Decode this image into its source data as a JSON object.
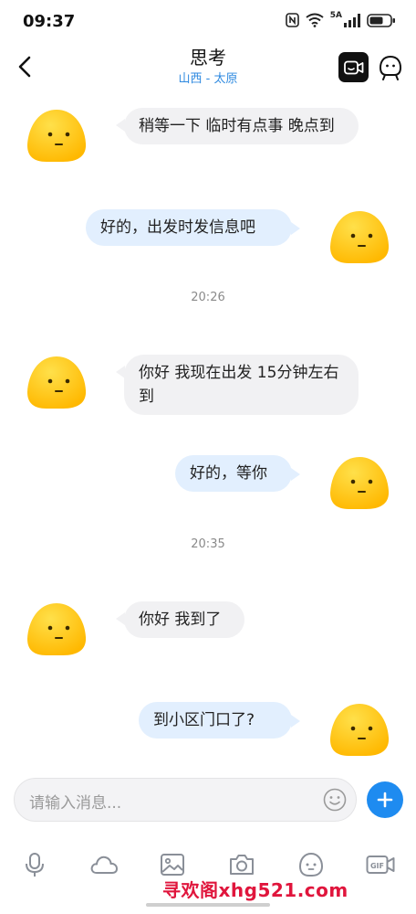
{
  "status_bar": {
    "time": "09:37",
    "network": "5A",
    "icons": [
      "nfc-icon",
      "wifi-icon",
      "signal-icon",
      "battery-icon"
    ]
  },
  "header": {
    "back_icon": "chevron-left-icon",
    "title": "思考",
    "subtitle": "山西 - 太原",
    "video_icon": "video-call-icon",
    "profile_icon": "profile-icon"
  },
  "messages": [
    {
      "direction": "in",
      "text": "稍等一下 临时有点事 晚点到"
    },
    {
      "direction": "out",
      "text": "好的，出发时发信息吧"
    },
    {
      "type": "time",
      "text": "20:26"
    },
    {
      "direction": "in",
      "text": "你好 我现在出发 15分钟左右到"
    },
    {
      "direction": "out",
      "text": "好的，等你"
    },
    {
      "type": "time",
      "text": "20:35"
    },
    {
      "direction": "in",
      "text": "你好 我到了"
    },
    {
      "direction": "out",
      "text": "到小区门口了?"
    }
  ],
  "input": {
    "placeholder": "请输入消息...",
    "emoji_icon": "smiley-icon",
    "plus_icon": "plus-icon"
  },
  "toolbar": [
    "microphone-icon",
    "cloud-icon",
    "image-icon",
    "camera-icon",
    "sticker-icon",
    "gif-icon"
  ],
  "watermark": "寻欢阁xhg521.com",
  "colors": {
    "accent": "#1e8bf0",
    "subtitle": "#2f8ae0",
    "bubble_in": "#f1f1f3",
    "bubble_out": "#e2effe",
    "avatar": "#ffc400",
    "watermark": "#e0153c"
  }
}
